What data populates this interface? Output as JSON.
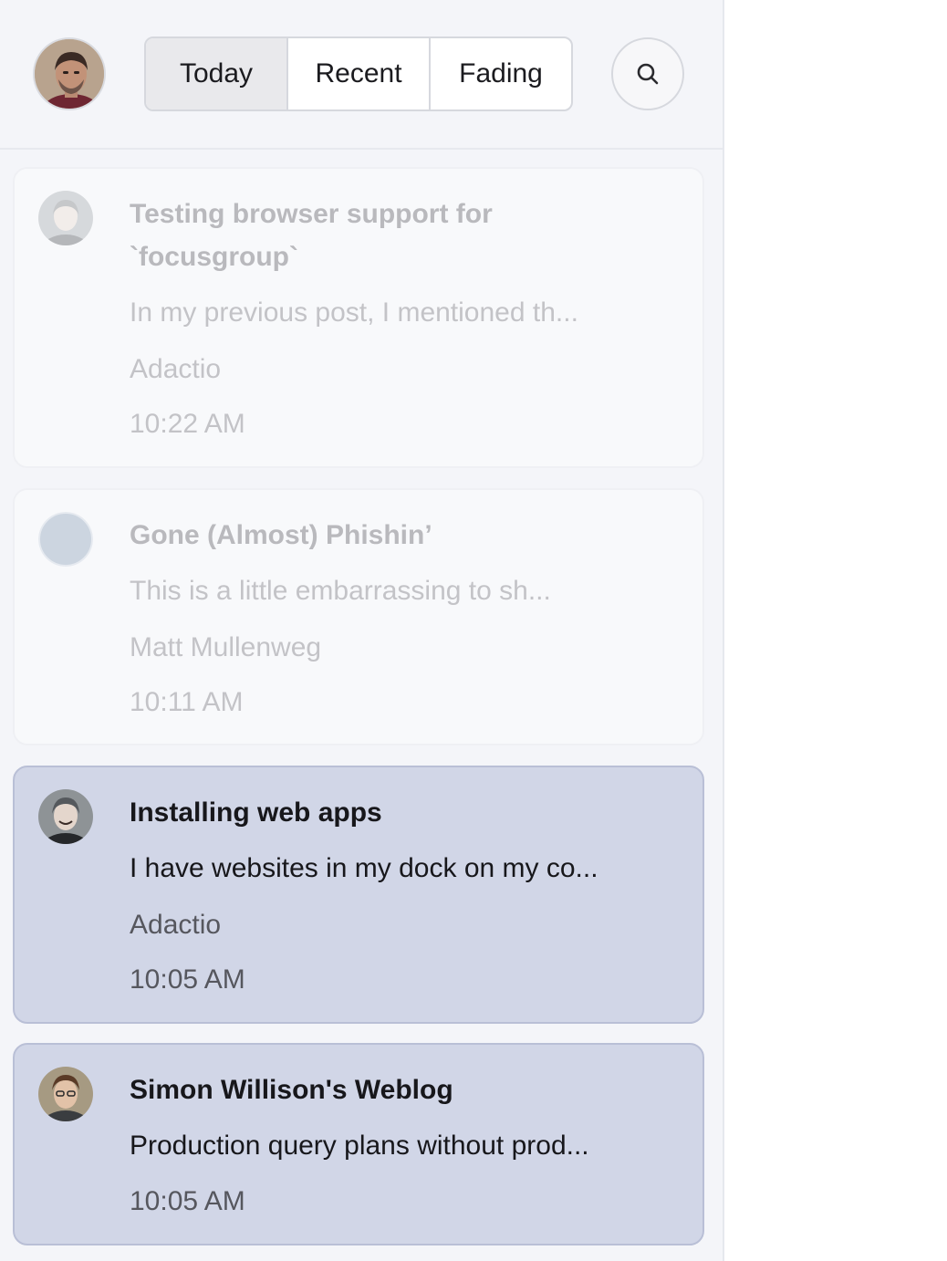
{
  "tabs": [
    {
      "label": "Today",
      "active": true
    },
    {
      "label": "Recent",
      "active": false
    },
    {
      "label": "Fading",
      "active": false
    }
  ],
  "icons": {
    "search": "search-icon",
    "profile": "user-avatar"
  },
  "colors": {
    "panel_bg": "#f4f5f9",
    "unread_bg": "#d1d6e7",
    "faded_text": "#c3c3c7"
  },
  "feed": [
    {
      "title": "Testing browser support for `focusgroup`",
      "excerpt": "In my previous post, I mentioned th...",
      "author": "Adactio",
      "time": "10:22 AM",
      "state": "faded"
    },
    {
      "title": "Gone (Almost) Phishin’",
      "excerpt": "This is a little embarrassing to sh...",
      "author": "Matt Mullenweg",
      "time": "10:11 AM",
      "state": "faded"
    },
    {
      "title": "Installing web apps",
      "excerpt": "I have websites in my dock on my co...",
      "author": "Adactio",
      "time": "10:05 AM",
      "state": "unread"
    },
    {
      "title": "Simon Willison's Weblog",
      "excerpt": "Production query plans without prod...",
      "time": "10:05 AM",
      "state": "unread"
    }
  ]
}
